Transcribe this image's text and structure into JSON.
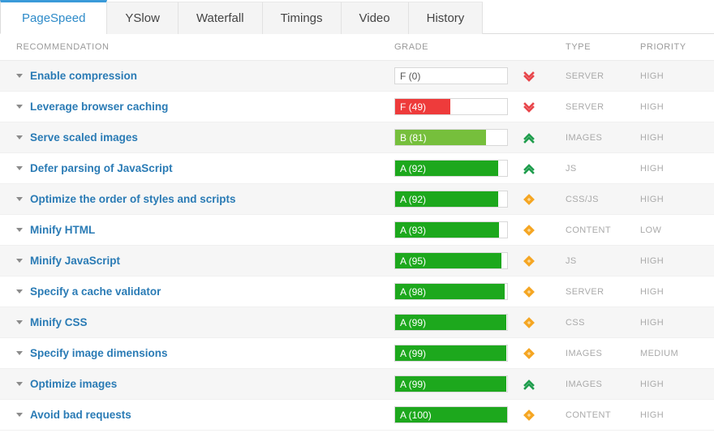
{
  "tabs": [
    {
      "label": "PageSpeed",
      "active": true
    },
    {
      "label": "YSlow",
      "active": false
    },
    {
      "label": "Waterfall",
      "active": false
    },
    {
      "label": "Timings",
      "active": false
    },
    {
      "label": "Video",
      "active": false
    },
    {
      "label": "History",
      "active": false
    }
  ],
  "colors": {
    "accent": "#3a9ad9",
    "link": "#2a7bb5",
    "grade_f": "#ee3b3b",
    "grade_b": "#76bf3c",
    "grade_a": "#1da81d",
    "trend_down": "#e8454a",
    "trend_up": "#1f9d4d",
    "trend_flat": "#f5a623",
    "header_text": "#9a9a9a",
    "meta_text": "#aaaaaa"
  },
  "table": {
    "headers": {
      "recommendation": "RECOMMENDATION",
      "grade": "GRADE",
      "type": "TYPE",
      "priority": "PRIORITY"
    },
    "rows": [
      {
        "recommendation": "Enable compression",
        "grade": "F (0)",
        "score": 0,
        "grade_color": "#ee3b3b",
        "trend": "chevron-double-down-icon",
        "trend_color": "#e8454a",
        "type": "SERVER",
        "priority": "HIGH"
      },
      {
        "recommendation": "Leverage browser caching",
        "grade": "F (49)",
        "score": 49,
        "grade_color": "#ee3b3b",
        "trend": "chevron-double-down-icon",
        "trend_color": "#e8454a",
        "type": "SERVER",
        "priority": "HIGH"
      },
      {
        "recommendation": "Serve scaled images",
        "grade": "B (81)",
        "score": 81,
        "grade_color": "#76bf3c",
        "trend": "chevron-double-up-icon",
        "trend_color": "#1f9d4d",
        "type": "IMAGES",
        "priority": "HIGH"
      },
      {
        "recommendation": "Defer parsing of JavaScript",
        "grade": "A (92)",
        "score": 92,
        "grade_color": "#1da81d",
        "trend": "chevron-double-up-icon",
        "trend_color": "#1f9d4d",
        "type": "JS",
        "priority": "HIGH"
      },
      {
        "recommendation": "Optimize the order of styles and scripts",
        "grade": "A (92)",
        "score": 92,
        "grade_color": "#1da81d",
        "trend": "diamond-icon",
        "trend_color": "#f5a623",
        "type": "CSS/JS",
        "priority": "HIGH"
      },
      {
        "recommendation": "Minify HTML",
        "grade": "A (93)",
        "score": 93,
        "grade_color": "#1da81d",
        "trend": "diamond-icon",
        "trend_color": "#f5a623",
        "type": "CONTENT",
        "priority": "LOW"
      },
      {
        "recommendation": "Minify JavaScript",
        "grade": "A (95)",
        "score": 95,
        "grade_color": "#1da81d",
        "trend": "diamond-icon",
        "trend_color": "#f5a623",
        "type": "JS",
        "priority": "HIGH"
      },
      {
        "recommendation": "Specify a cache validator",
        "grade": "A (98)",
        "score": 98,
        "grade_color": "#1da81d",
        "trend": "diamond-icon",
        "trend_color": "#f5a623",
        "type": "SERVER",
        "priority": "HIGH"
      },
      {
        "recommendation": "Minify CSS",
        "grade": "A (99)",
        "score": 99,
        "grade_color": "#1da81d",
        "trend": "diamond-icon",
        "trend_color": "#f5a623",
        "type": "CSS",
        "priority": "HIGH"
      },
      {
        "recommendation": "Specify image dimensions",
        "grade": "A (99)",
        "score": 99,
        "grade_color": "#1da81d",
        "trend": "diamond-icon",
        "trend_color": "#f5a623",
        "type": "IMAGES",
        "priority": "MEDIUM"
      },
      {
        "recommendation": "Optimize images",
        "grade": "A (99)",
        "score": 99,
        "grade_color": "#1da81d",
        "trend": "chevron-double-up-icon",
        "trend_color": "#1f9d4d",
        "type": "IMAGES",
        "priority": "HIGH"
      },
      {
        "recommendation": "Avoid bad requests",
        "grade": "A (100)",
        "score": 100,
        "grade_color": "#1da81d",
        "trend": "diamond-icon",
        "trend_color": "#f5a623",
        "type": "CONTENT",
        "priority": "HIGH"
      }
    ]
  }
}
